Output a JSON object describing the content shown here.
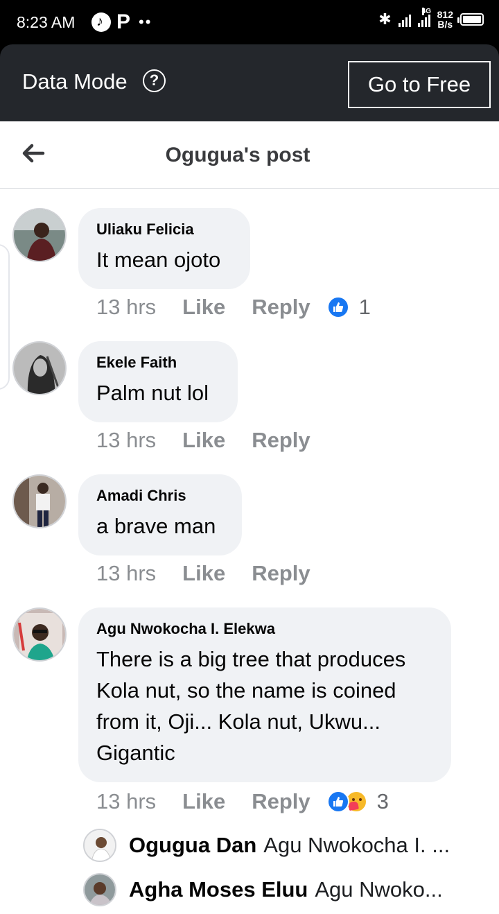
{
  "status_bar": {
    "time": "8:23 AM",
    "network": "4G",
    "speed_top": "812",
    "speed_bottom": "B/s",
    "icons": [
      "music-icon",
      "p-icon",
      "more-dots-icon",
      "bluetooth-icon",
      "signal-icon",
      "battery-icon"
    ]
  },
  "banner": {
    "label": "Data Mode",
    "help_symbol": "?",
    "button_label": "Go to Free"
  },
  "header": {
    "title": "Ogugua's post",
    "back_icon": "back-arrow-icon"
  },
  "colors": {
    "banner_bg": "#24272c",
    "bubble_bg": "#f0f2f5",
    "like_blue": "#1877f2",
    "muted_text": "#8a8d91"
  },
  "comments": [
    {
      "author": "Uliaku Felicia",
      "text": "It mean ojoto",
      "time": "13 hrs",
      "like_label": "Like",
      "reply_label": "Reply",
      "reaction_count": "1",
      "reactions": [
        "like"
      ]
    },
    {
      "author": "Ekele Faith",
      "text": "Palm nut lol",
      "time": "13 hrs",
      "like_label": "Like",
      "reply_label": "Reply",
      "reaction_count": "",
      "reactions": []
    },
    {
      "author": "Amadi Chris",
      "text": "a brave man",
      "time": "13 hrs",
      "like_label": "Like",
      "reply_label": "Reply",
      "reaction_count": "",
      "reactions": []
    },
    {
      "author": "Agu Nwokocha I. Elekwa",
      "text_lines": [
        "There is a big tree that produces",
        "Kola nut, so the name is coined",
        "from it, Oji... Kola nut, Ukwu...",
        "Gigantic"
      ],
      "time": "13 hrs",
      "like_label": "Like",
      "reply_label": "Reply",
      "reaction_count": "3",
      "reactions": [
        "like",
        "care"
      ]
    }
  ],
  "replies": [
    {
      "name": "Ogugua Dan",
      "snippet": "Agu Nwokocha I. ..."
    },
    {
      "name": "Agha Moses Eluu",
      "snippet": "Agu Nwoko..."
    }
  ]
}
